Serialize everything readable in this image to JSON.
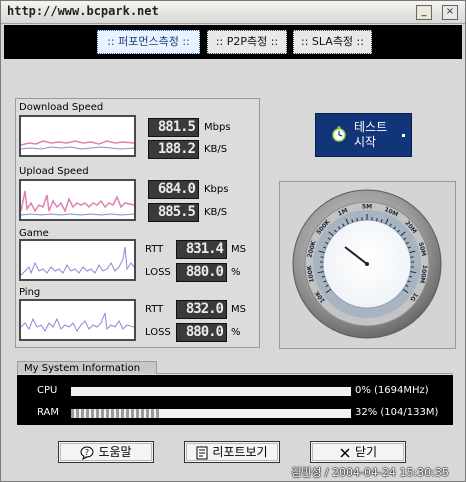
{
  "window": {
    "title": "http://www.bcpark.net"
  },
  "tabs": [
    {
      "label": ":: 퍼포먼스측정 ::",
      "active": true
    },
    {
      "label": ":: P2P측정 ::",
      "active": false
    },
    {
      "label": ":: SLA측정 ::",
      "active": false
    }
  ],
  "download": {
    "label": "Download Speed",
    "value1": "881.5",
    "ghost1": "",
    "unit1": "Mbps",
    "value2": "188.2",
    "unit2": "KB/S"
  },
  "upload": {
    "label": "Upload Speed",
    "value1": "684.0",
    "unit1": "Kbps",
    "value2": "885.5",
    "unit2": "KB/S"
  },
  "game": {
    "label": "Game",
    "rtt_label": "RTT",
    "rtt_value": "831.4",
    "rtt_unit": "MS",
    "loss_label": "LOSS",
    "loss_value": "880.0",
    "loss_unit": "%"
  },
  "ping": {
    "label": "Ping",
    "rtt_label": "RTT",
    "rtt_value": "832.0",
    "rtt_unit": "MS",
    "loss_label": "LOSS",
    "loss_value": "880.0",
    "loss_unit": "%"
  },
  "start_button": {
    "label_line1": "테스트",
    "label_line2": "시작"
  },
  "gauge": {
    "scale_labels": [
      "10K",
      "100K",
      "200K",
      "500K",
      "1M",
      "5M",
      "10M",
      "20M",
      "50M",
      "100M",
      "1G"
    ],
    "needle_label": "10K"
  },
  "system_info": {
    "title": "My System Information",
    "cpu": {
      "label": "CPU",
      "value": "0% (1694MHz)",
      "fraction": 0.0
    },
    "ram": {
      "label": "RAM",
      "value": "32% (104/133M)",
      "fraction": 0.32
    }
  },
  "buttons": {
    "help": "도움말",
    "report": "리포트보기",
    "close": "닫기"
  },
  "footer": {
    "text": "김민성 / 2004-04-24 15:30:35"
  },
  "colors": {
    "accent": "#12357a",
    "graph_line": "#8a8ad8",
    "graph_pink": "#e080b0",
    "lcd_bg": "#3a3a3a"
  }
}
